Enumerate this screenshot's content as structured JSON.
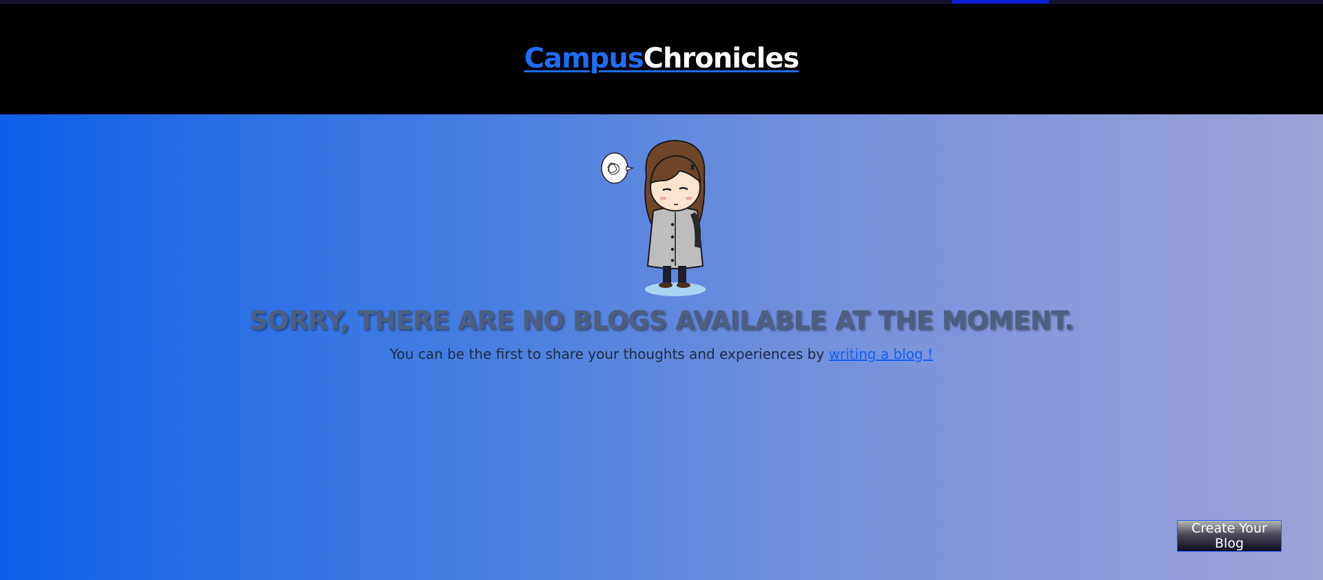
{
  "brand": {
    "part1": "Campus",
    "part2": "Chronicles"
  },
  "empty_state": {
    "illustration": "confused-girl-illustration",
    "headline": "SORRY, THERE ARE NO BLOGS AVAILABLE AT THE MOMENT.",
    "message_prefix": "You can be the first to share your thoughts and experiences by ",
    "link_text": "writing a blog !"
  },
  "actions": {
    "create_label": "Create Your Blog"
  },
  "colors": {
    "brand_accent": "#1f6cf5",
    "header_bg": "#000000",
    "gradient_start": "#0d5fe8",
    "gradient_end": "#a0a3d8",
    "headline": "#4d5f80"
  }
}
